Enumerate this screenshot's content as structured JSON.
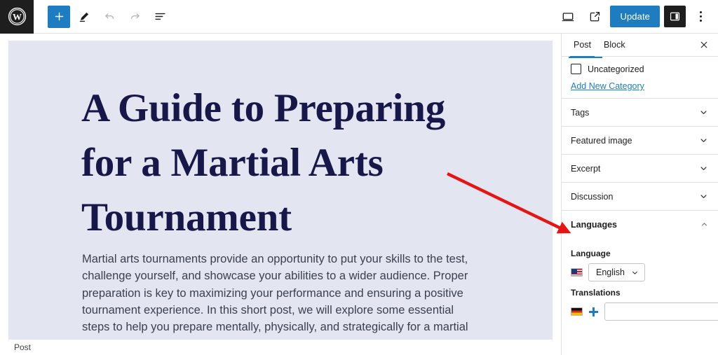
{
  "app": {
    "logo_icon": "wordpress-logo-icon"
  },
  "toolbar": {
    "add_block_icon": "plus-icon",
    "tools_icon": "pencil-icon",
    "undo_icon": "undo-arrow-icon",
    "redo_icon": "redo-arrow-icon",
    "list_view_icon": "document-overview-icon",
    "preview_icon": "desktop-preview-icon",
    "view_post_icon": "external-link-icon",
    "update_label": "Update",
    "settings_toggle_icon": "settings-sidebar-icon",
    "options_icon": "kebab-menu-icon",
    "accent_color": "#1d7dc0",
    "dark_color": "#1e1e1e"
  },
  "editor": {
    "canvas_background": "#e3e6f0",
    "title": "A Guide to Preparing for a Martial Arts Tournament",
    "body": "Martial arts tournaments provide an opportunity to put your skills to the test, challenge yourself, and showcase your abilities to a wider audience. Proper preparation is key to maximizing your performance and ensuring a positive tournament experience. In this short post, we will explore some essential steps to help you prepare mentally, physically, and strategically for a martial arts",
    "title_color": "#17174a",
    "body_color": "#3b4050"
  },
  "statusbar": {
    "breadcrumb": "Post"
  },
  "sidebar": {
    "tabs": [
      {
        "label": "Post",
        "active": true
      },
      {
        "label": "Block",
        "active": false
      }
    ],
    "close_icon": "close-icon",
    "category": {
      "checkbox_checked": false,
      "label": "Uncategorized",
      "add_link": "Add New Category"
    },
    "panels": [
      {
        "label": "Tags",
        "open": false,
        "chevron": "chevron-down-icon"
      },
      {
        "label": "Featured image",
        "open": false,
        "chevron": "chevron-down-icon"
      },
      {
        "label": "Excerpt",
        "open": false,
        "chevron": "chevron-down-icon"
      },
      {
        "label": "Discussion",
        "open": false,
        "chevron": "chevron-down-icon"
      },
      {
        "label": "Languages",
        "open": true,
        "chevron": "chevron-up-icon"
      }
    ],
    "languages": {
      "language_label": "Language",
      "language_flag_icon": "flag-us-icon",
      "language_value": "English",
      "language_dropdown_icon": "chevron-down-icon",
      "translations_label": "Translations",
      "translation_flag_icon": "flag-de-icon",
      "add_translation_icon": "plus-icon",
      "translation_value": "",
      "translation_placeholder": ""
    }
  },
  "annotation": {
    "arrow_color": "#e81313",
    "arrow_from": "638,248",
    "arrow_to": "815,333"
  }
}
